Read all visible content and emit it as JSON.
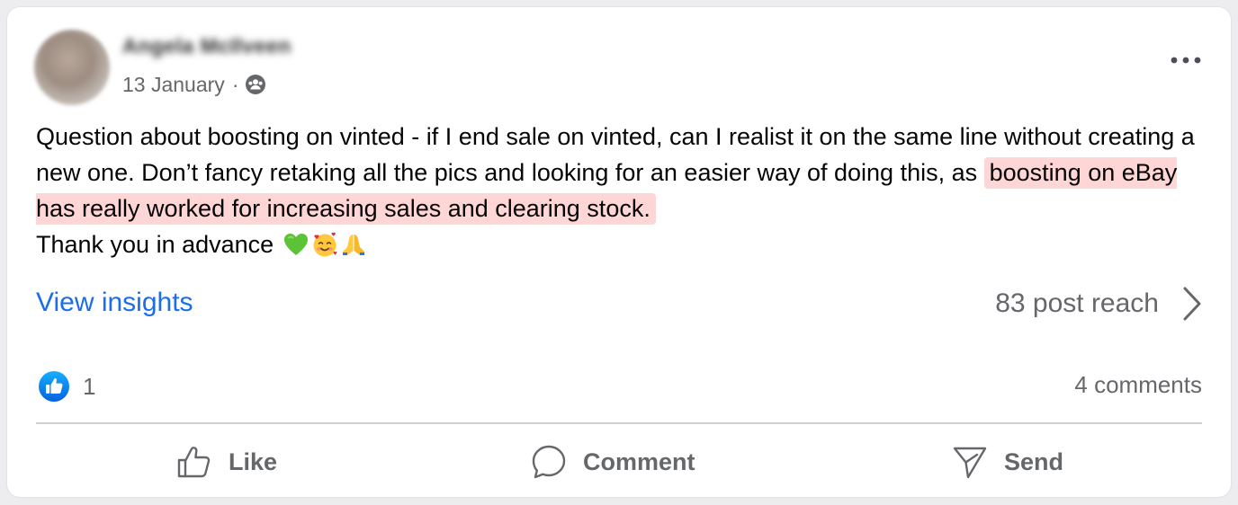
{
  "post": {
    "author_name": "Angela McIlveen",
    "date": "13 January",
    "separator": "·",
    "audience_icon": "group-audience-icon",
    "more_icon": "more-dots-icon",
    "text_part1": "Question about boosting on vinted - if I end sale on vinted, can I realist it on the same line without creating a new one. Don’t fancy retaking all the pics and looking for an easier way of doing this, as",
    "text_highlight": "boosting on eBay has really worked for increasing sales and clearing stock.",
    "text_part2": "Thank you in advance",
    "emojis": [
      "green-heart-emoji",
      "smiling-face-with-hearts-emoji",
      "folded-hands-emoji"
    ],
    "highlight_color": "#ffd6d6"
  },
  "insights": {
    "link_label": "View insights",
    "reach_label": "83 post reach"
  },
  "engagement": {
    "reaction_icon": "like-reaction-icon",
    "reaction_count": "1",
    "comments_label": "4 comments"
  },
  "actions": {
    "like_label": "Like",
    "comment_label": "Comment",
    "send_label": "Send"
  },
  "colors": {
    "accent": "#1b6ee8",
    "secondary_text": "#65676b",
    "primary_text": "#050505"
  }
}
